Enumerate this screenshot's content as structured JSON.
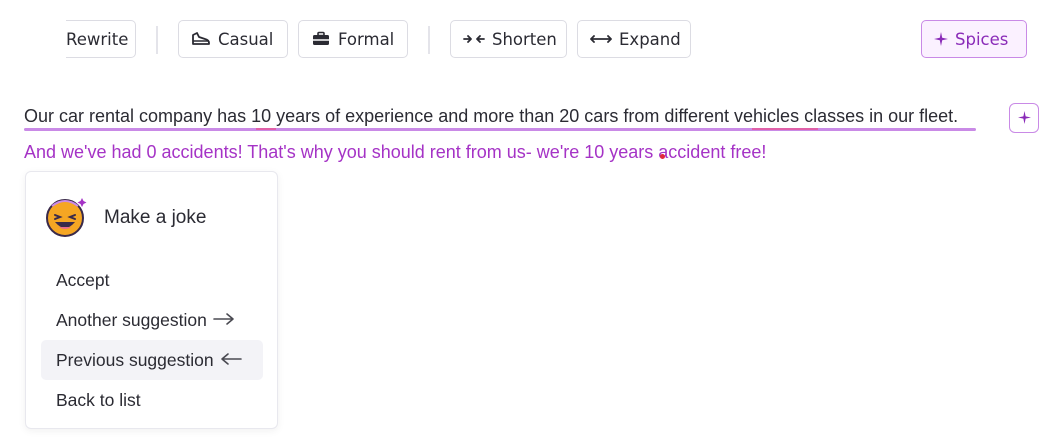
{
  "toolbar": {
    "rewrite_label": "Rewrite",
    "casual_label": "Casual",
    "formal_label": "Formal",
    "shorten_label": "Shorten",
    "expand_label": "Expand",
    "spices_label": "Spices"
  },
  "editor": {
    "line1": "Our car rental company has 10 years of experience and more than 20 cars from different vehicles classes in our fleet.",
    "suggestion": "And we've had 0 accidents! That's why you should rent from us- we're 10 years accident free!"
  },
  "popup": {
    "title": "Make a joke",
    "icon": "laughing-emoji-icon",
    "items": [
      {
        "label": "Accept"
      },
      {
        "label": "Another suggestion"
      },
      {
        "label": "Previous suggestion"
      },
      {
        "label": "Back to list"
      }
    ]
  },
  "colors": {
    "accent": "#a533c6",
    "underline": "#c98ae6",
    "spelling": "#e060a8"
  }
}
